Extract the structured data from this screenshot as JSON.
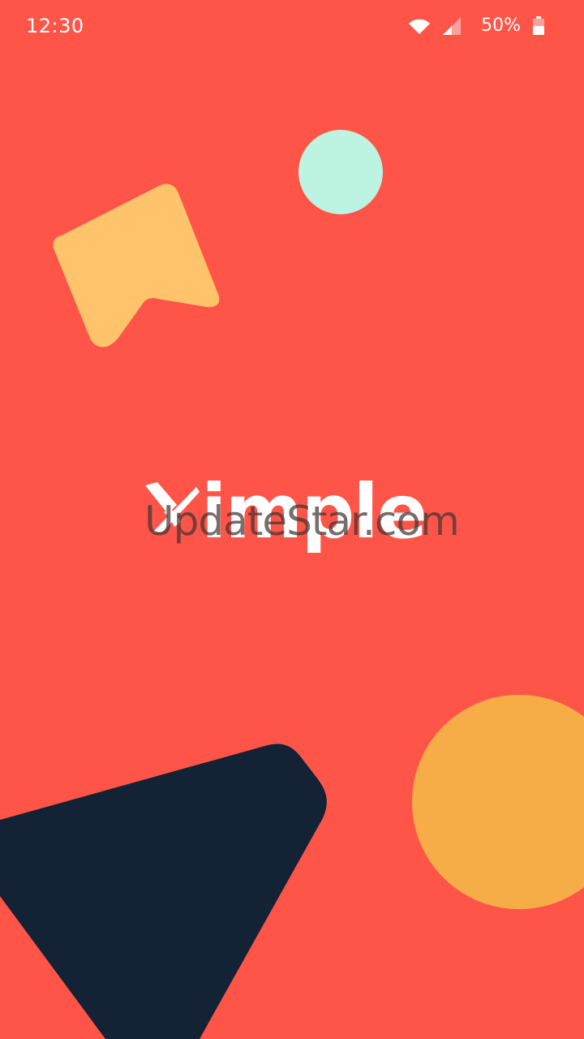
{
  "status_bar": {
    "time": "12:30",
    "battery_percent": "50%",
    "icons": [
      "wifi-icon",
      "signal-icon",
      "battery-icon"
    ]
  },
  "splash": {
    "logo_text": "imple",
    "watermark_text": "UpdateStar.com"
  },
  "colors": {
    "background": "#ff5548",
    "bubble": "#ffc36b",
    "mint": "#bdf3e1",
    "orange": "#f7ad47",
    "navy": "#132234",
    "white": "#ffffff"
  }
}
